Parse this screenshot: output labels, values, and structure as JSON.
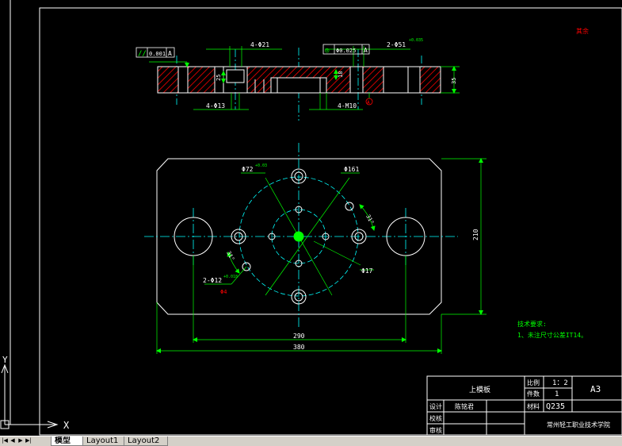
{
  "colors": {
    "background": "#000000",
    "frame": "#ffffff",
    "outline": "#ffffff",
    "dimension": "#00ff00",
    "centerline": "#00ffff",
    "hatch": "#ff0000",
    "accent_yellow": "#ffff00",
    "tab_bar": "#d4d0c8"
  },
  "corner_note": "其余",
  "section_view": {
    "dims": {
      "top_holes": "4-Φ21",
      "bottom_holes": "4-Φ13",
      "pins": "2-Φ51",
      "pins_tol": "+0.035",
      "threads": "4-M10",
      "depth_left": "25",
      "depth_mid": "18",
      "thickness": "35"
    },
    "gdt_parallel": {
      "symbol": "//",
      "value": "0.001",
      "datum": "A"
    },
    "gdt_position": {
      "symbol": "◎",
      "value": "Φ0.025",
      "datum": "A"
    },
    "datum_mark": "A"
  },
  "plan_view": {
    "dims": {
      "pcd_large": "Φ72",
      "pcd_large_tol": "+0.03",
      "pcd_outer": "Φ161",
      "angle_right": "31°",
      "angle_left": "31°",
      "pin_holes": "2-Φ12",
      "pin_holes_tol": "+0.018",
      "center_hole": "Φ17",
      "inner_width": "290",
      "outer_width": "380",
      "height": "210",
      "red_mark": "Φ4"
    }
  },
  "tech_requirements": {
    "title": "技术要求:",
    "item1": "1、未注尺寸公差IT14。"
  },
  "title_block": {
    "part_name": "上模板",
    "scale_label": "比例",
    "scale_value": "1：2",
    "qty_label": "件数",
    "qty_value": "1",
    "sheet_size": "A3",
    "material_label": "材料",
    "material_value": "Q235",
    "designer_label": "设计",
    "designer_name": "陈铭君",
    "checker_label": "校核",
    "approver_label": "审核",
    "school": "常州轻工职业技术学院"
  },
  "ucs": {
    "x_label": "X",
    "y_label": "Y"
  },
  "tabs": {
    "model": "模型",
    "layout1": "Layout1",
    "layout2": "Layout2"
  },
  "tab_nav": [
    "|◀",
    "◀",
    "▶",
    "▶|"
  ]
}
